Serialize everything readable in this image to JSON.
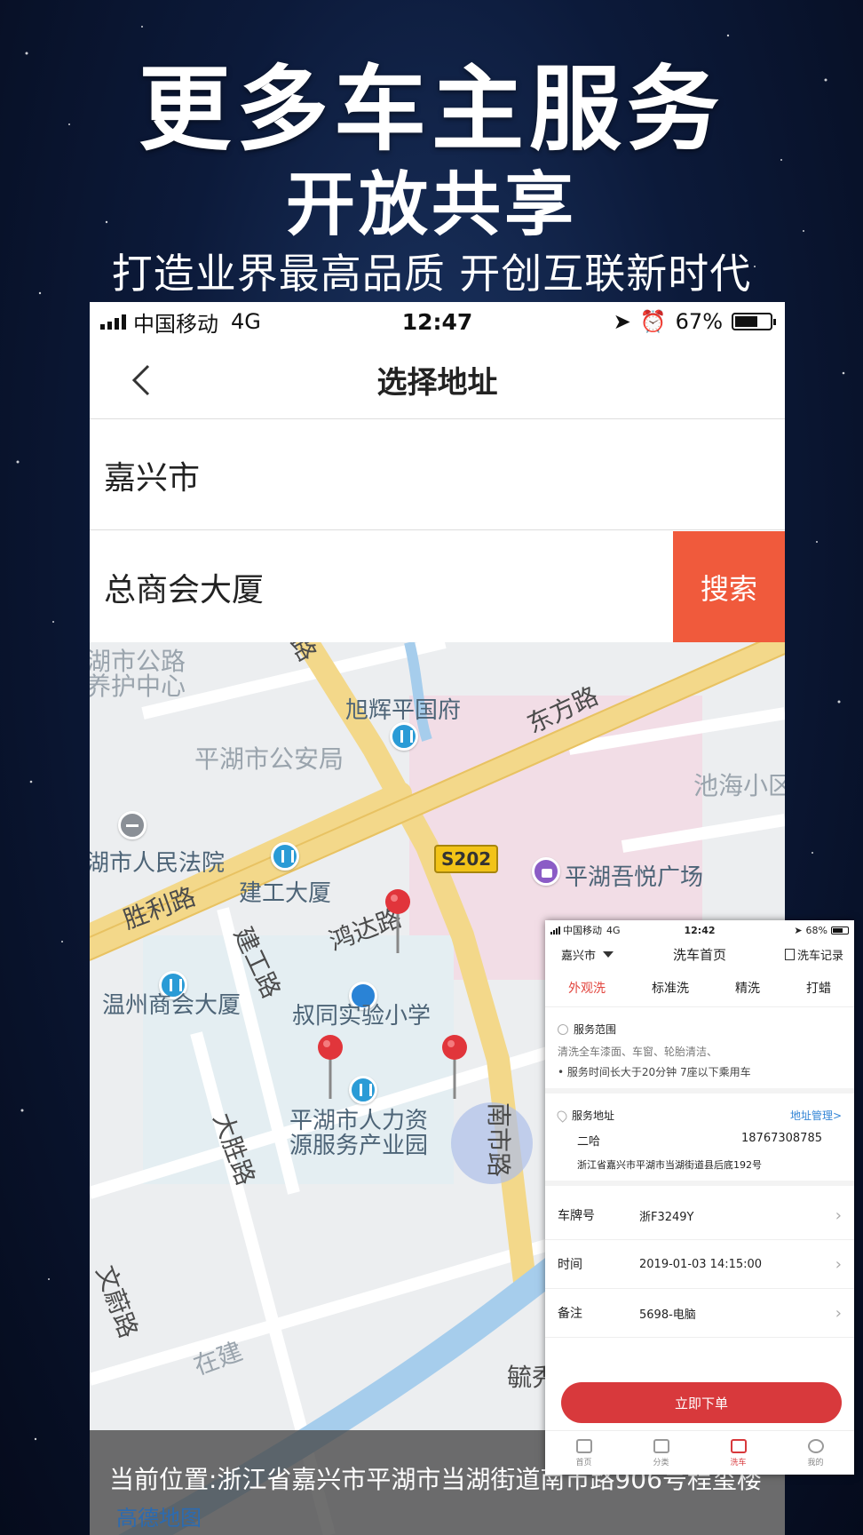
{
  "promo": {
    "title": "更多车主服务",
    "subtitle": "开放共享",
    "tagline": "打造业界最高品质  开创互联新时代"
  },
  "main_phone": {
    "status": {
      "carrier": "中国移动",
      "network": "4G",
      "time": "12:47",
      "battery": "67%",
      "battery_level": 0.67
    },
    "nav": {
      "title": "选择地址"
    },
    "city": "嘉兴市",
    "search": {
      "value": "总商会大厦",
      "button": "搜索"
    },
    "map": {
      "labels": {
        "road_service": "湖市公路",
        "road_service2": "养护中心",
        "xuhui": "旭辉平国府",
        "police": "平湖市公安局",
        "dongfang": "东方路",
        "chihai": "池海小区",
        "court": "湖市人民法院",
        "jiangong": "建工大厦",
        "route": "S202",
        "mall": "平湖吾悦广场",
        "shengli": "胜利路",
        "hongda": "鸿达路",
        "jiangong_road": "建工路",
        "wenzhou": "温州商会大厦",
        "school": "叔同实验小学",
        "hr_park1": "平湖市人力资",
        "hr_park2": "源服务产业园",
        "dasheng": "大胜路",
        "nanshi": "南市路",
        "wenwei": "文蔚路",
        "zaijian": "在建",
        "yuhe": "毓秀",
        "road_top": "路"
      },
      "current_location": "当前位置:浙江省嘉兴市平湖市当湖街道南市路906号程玺楼",
      "provider": "高德地图"
    }
  },
  "second_phone": {
    "status": {
      "carrier": "中国移动",
      "network": "4G",
      "time": "12:42",
      "battery": "68%",
      "battery_level": 0.68
    },
    "header": {
      "city": "嘉兴市",
      "title": "洗车首页",
      "record": "洗车记录"
    },
    "tabs": [
      "外观洗",
      "标准洗",
      "精洗",
      "打蜡"
    ],
    "service_scope": {
      "title": "服务范围",
      "line1": "清洗全车漆面、车窗、轮胎清洁、",
      "line2": "• 服务时间长大于20分钟     7座以下乘用车"
    },
    "service_address": {
      "title": "服务地址",
      "manage": "地址管理>",
      "name": "二哈",
      "phone": "18767308785",
      "address": "浙江省嘉兴市平湖市当湖街道县后底192号"
    },
    "rows": [
      {
        "label": "车牌号",
        "value": "浙F3249Y"
      },
      {
        "label": "时间",
        "value": "2019-01-03 14:15:00"
      },
      {
        "label": "备注",
        "value": "5698-电脑"
      }
    ],
    "order_button": "立即下单",
    "tabbar": [
      "首页",
      "分类",
      "洗车",
      "我的"
    ]
  }
}
